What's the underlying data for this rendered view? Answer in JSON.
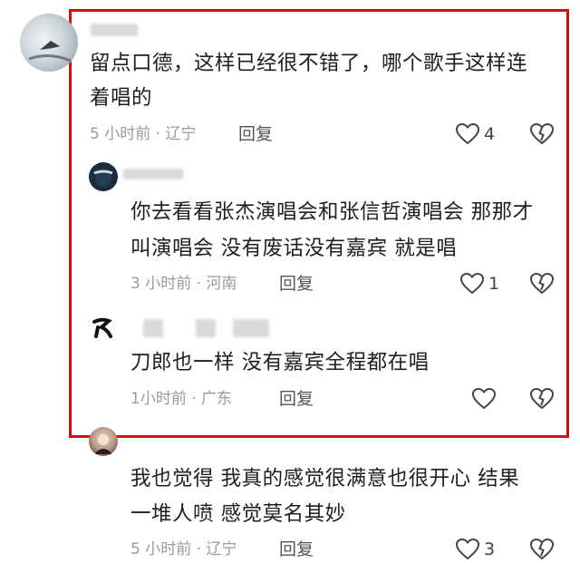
{
  "comments": [
    {
      "text_line1": "留点口德，这样已经很不错了，哪个歌手这样连",
      "text_line2": "着唱的",
      "time_location": "5 小时前 · 辽宁",
      "reply_label": "回复",
      "like_count": "4"
    },
    {
      "text_line1": "你去看看张杰演唱会和张信哲演唱会 那那才",
      "text_line2": "叫演唱会 没有废话没有嘉宾 就是唱",
      "time_location": "3 小时前 · 河南",
      "reply_label": "回复",
      "like_count": "1"
    },
    {
      "text_line1": "刀郎也一样 没有嘉宾全程都在唱",
      "time_location": "1小时前 · 广东",
      "reply_label": "回复",
      "like_count": ""
    },
    {
      "text_line1": "我也觉得 我真的感觉很满意也很开心 结果",
      "text_line2": "一堆人喷 感觉莫名其妙",
      "time_location": "5 小时前 · 辽宁",
      "reply_label": "回复",
      "like_count": "3"
    }
  ],
  "colors": {
    "highlight_border": "#d01212",
    "text": "#1f1f1f",
    "meta": "#9a9a9a"
  }
}
